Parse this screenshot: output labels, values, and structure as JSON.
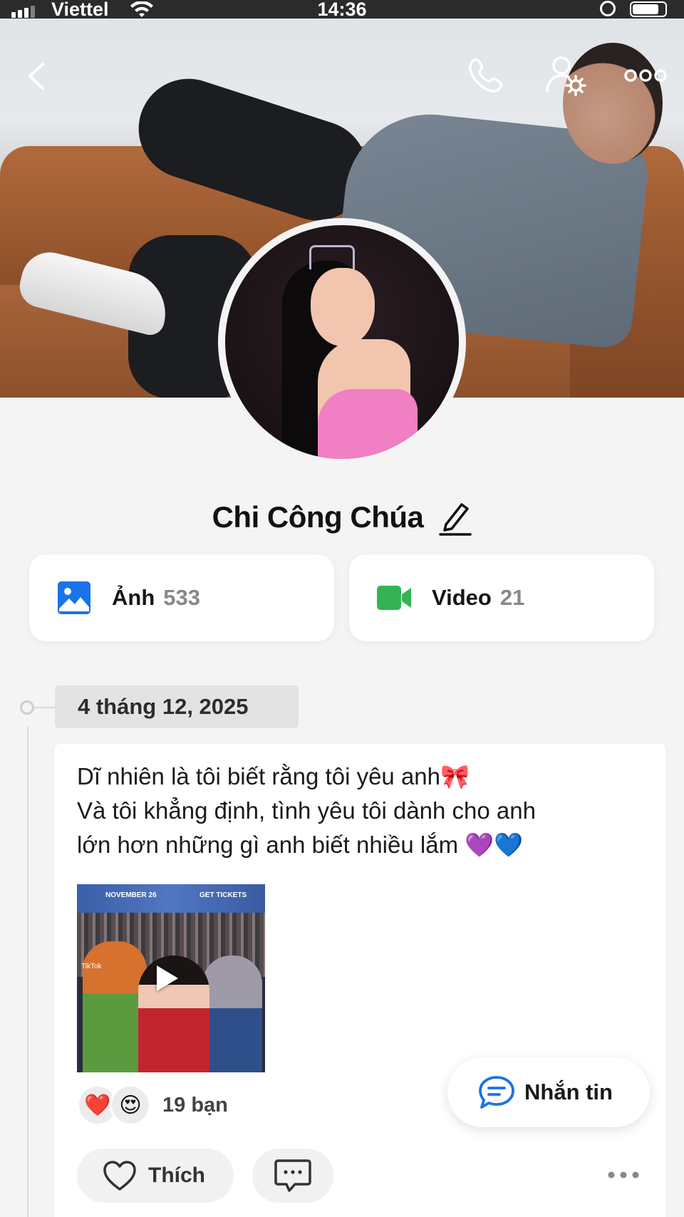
{
  "status_bar": {
    "carrier": "Viettel",
    "time": "14:36"
  },
  "profile": {
    "name": "Chi Công Chúa"
  },
  "media": {
    "photos": {
      "label": "Ảnh",
      "count": "533",
      "icon": "image-icon",
      "color": "#1a73e8"
    },
    "videos": {
      "label": "Video",
      "count": "21",
      "icon": "video-camera-icon",
      "color": "#34b356"
    }
  },
  "timeline": {
    "date": "4 tháng 12, 2025"
  },
  "post": {
    "lines": [
      "Dĩ nhiên là tôi biết rằng tôi yêu anh🎀",
      "Và tôi khẳng định, tình yêu tôi dành cho anh",
      "lớn hơn những gì anh biết nhiều lắm 💜💙"
    ],
    "thumbnail": {
      "banner_left": "NOVEMBER 26",
      "banner_right": "GET TICKETS",
      "watermark": "TikTok"
    },
    "reactions": {
      "emojis": [
        "❤️",
        "😍"
      ],
      "count_label": "19 bạn"
    },
    "like_label": "Thích"
  },
  "actions": {
    "message_label": "Nhắn tin"
  },
  "colors": {
    "accent": "#1a73e8",
    "video": "#34b356",
    "like_heart": "#333333"
  }
}
